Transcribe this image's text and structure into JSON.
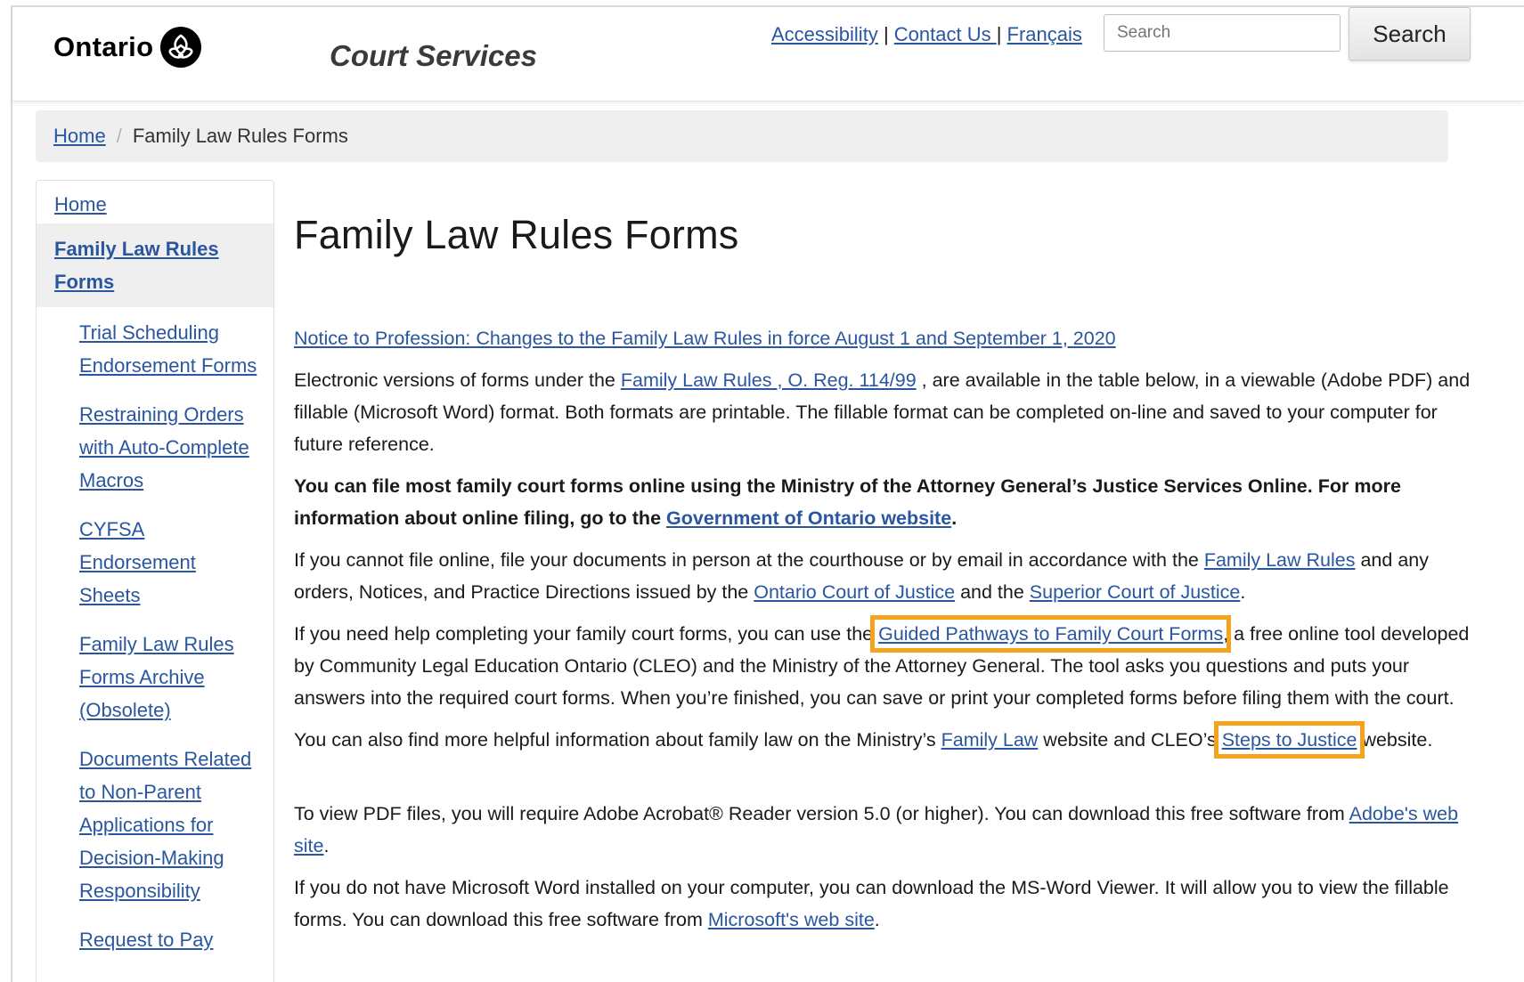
{
  "header": {
    "logo_text": "Ontario",
    "site_title": "Court Services",
    "links": [
      "Accessibility",
      "Contact Us ",
      "Français"
    ],
    "search_placeholder": "Search",
    "search_button": "Search"
  },
  "breadcrumb": {
    "home": "Home",
    "current": "Family Law Rules Forms"
  },
  "sidebar": {
    "home": "Home",
    "active": "Family Law Rules Forms",
    "items": [
      "Trial Scheduling Endorsement Forms",
      "Restraining Orders with Auto-Complete Macros",
      "CYFSA Endorsement Sheets",
      "Family Law Rules Forms Archive (Obsolete)",
      "Documents Related to Non-Parent Applications for Decision-Making Responsibility",
      "Request to Pay"
    ]
  },
  "main": {
    "title": "Family Law Rules Forms",
    "notice_link": "Notice to Profession: Changes to the Family Law Rules in force August 1 and September 1, 2020",
    "p1_a": "Electronic versions of forms under the ",
    "p1_link": "Family Law Rules , O. Reg. 114/99",
    "p1_b": " , are available in the table below, in a viewable (Adobe PDF) and fillable (Microsoft Word) format. Both formats are printable. The fillable format can be completed on-line and saved to your computer for future reference.",
    "p2_a": "You can file most family court forms online using the Ministry of the Attorney General’s Justice Services Online. For more information about online filing, go to the ",
    "p2_link": "Government of Ontario website",
    "p2_b": ".",
    "p3_a": "If you cannot file online, file your documents in person at the courthouse or by email in accordance with the ",
    "p3_link1": "Family Law Rules",
    "p3_b": " and any orders, Notices, and Practice Directions issued by the ",
    "p3_link2": "Ontario Court of Justice",
    "p3_c": " and the ",
    "p3_link3": "Superior Court of Justice",
    "p3_d": ".",
    "p4_a": "If you need help completing your family court forms, you can use the ",
    "p4_link": "Guided Pathways to Family Court Forms",
    "p4_b": ", a free online tool developed by Community Legal Education Ontario (CLEO) and the Ministry of the Attorney General. The tool asks you questions and puts your answers into the required court forms. When you’re finished, you can save or print your completed forms before filing them with the court.",
    "p5_a": "You can also find more helpful information about family law on the Ministry’s ",
    "p5_link1": "Family Law",
    "p5_b": " website and CLEO’s ",
    "p5_link2": "Steps to Justice",
    "p5_c": " website.",
    "p6_a": "To view PDF files, you will require Adobe Acrobat® Reader version 5.0 (or higher). You can download this free software from ",
    "p6_link": "Adobe's web site",
    "p6_b": ".",
    "p7_a": "If you do not have Microsoft Word installed on your computer, you can download the MS-Word Viewer. It will allow you to view the fillable forms. You can download this free software from ",
    "p7_link": "Microsoft's web site",
    "p7_b": "."
  },
  "colors": {
    "link": "#2a56a0",
    "highlight": "#f5a21d"
  },
  "icons": {
    "logo": "ontario-trillium-icon"
  }
}
